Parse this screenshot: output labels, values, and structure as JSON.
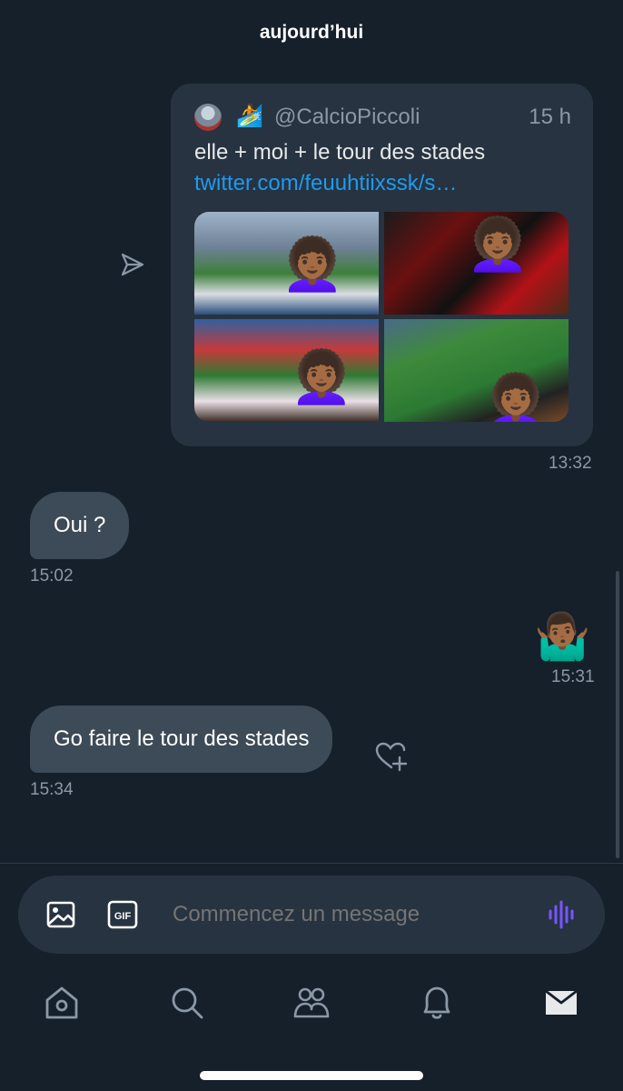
{
  "header": {
    "date": "aujourd’hui"
  },
  "shared_tweet": {
    "handle": "@CalcioPiccoli",
    "time_ago": "15 h",
    "emoji": "🏄",
    "text": "elle + moi + le tour des stades",
    "link": "twitter.com/feuuhtiixssk/s…",
    "photos": [
      {
        "emoji": "👩🏾‍🦱"
      },
      {
        "emoji": "👩🏾‍🦱"
      },
      {
        "emoji": "👩🏾‍🦱"
      },
      {
        "emoji": "👩🏾‍🦱"
      }
    ],
    "timestamp": "13:32"
  },
  "messages": [
    {
      "text": "Oui ?",
      "timestamp": "15:02",
      "direction": "incoming"
    },
    {
      "text": "🤷🏾‍♂️",
      "timestamp": "15:31",
      "direction": "outgoing"
    },
    {
      "text": "Go faire le tour des stades",
      "timestamp": "15:34",
      "direction": "incoming"
    }
  ],
  "composer": {
    "placeholder": "Commencez un message",
    "icons": [
      "image-icon",
      "gif-icon",
      "voice-icon"
    ],
    "gif_label": "GIF"
  },
  "bottom_nav": {
    "items": [
      "home-icon",
      "search-icon",
      "communities-icon",
      "notifications-icon",
      "messages-icon"
    ]
  },
  "colors": {
    "background": "#15202b",
    "bubble_incoming": "#3d4a57",
    "card": "#273340",
    "link": "#1d9bf0",
    "voice_accent": "#7856ff",
    "muted": "#8b98a5"
  }
}
